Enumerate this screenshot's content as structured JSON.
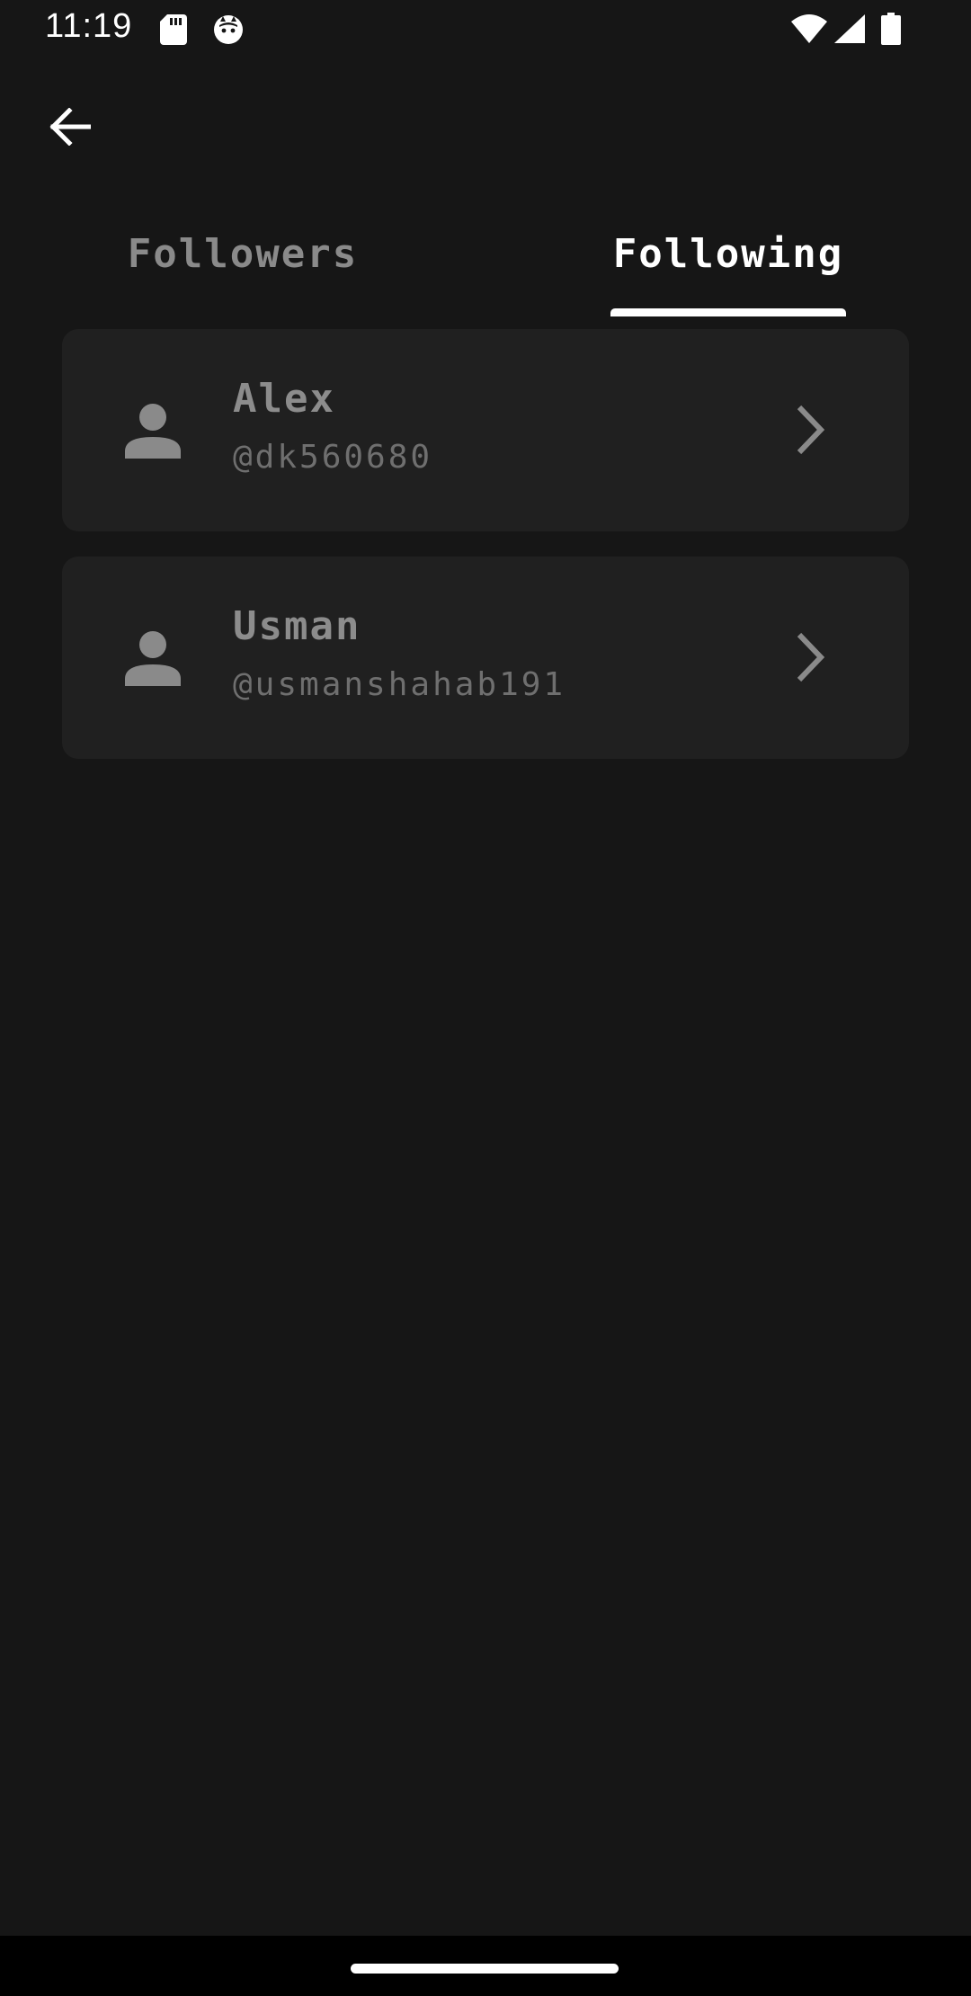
{
  "status_bar": {
    "time": "11:19",
    "left_icons": [
      "sd-card-icon",
      "cat-face-icon"
    ],
    "right_icons": [
      "wifi-icon",
      "signal-icon",
      "battery-icon"
    ]
  },
  "header": {
    "back_icon": "arrow-left-icon"
  },
  "tabs": [
    {
      "label": "Followers",
      "selected": false
    },
    {
      "label": "Following",
      "selected": true
    }
  ],
  "users": [
    {
      "name": "Alex",
      "handle": "@dk560680",
      "avatar_icon": "person-icon",
      "action_icon": "chevron-right-icon"
    },
    {
      "name": "Usman",
      "handle": "@usmanshahab191",
      "avatar_icon": "person-icon",
      "action_icon": "chevron-right-icon"
    }
  ],
  "colors": {
    "background": "#161616",
    "card": "#202020",
    "selected_tab": "#ffffff",
    "unselected_tab": "#8a8a8a",
    "name_text": "#8c8c8c",
    "handle_text": "#6f6f6f"
  }
}
